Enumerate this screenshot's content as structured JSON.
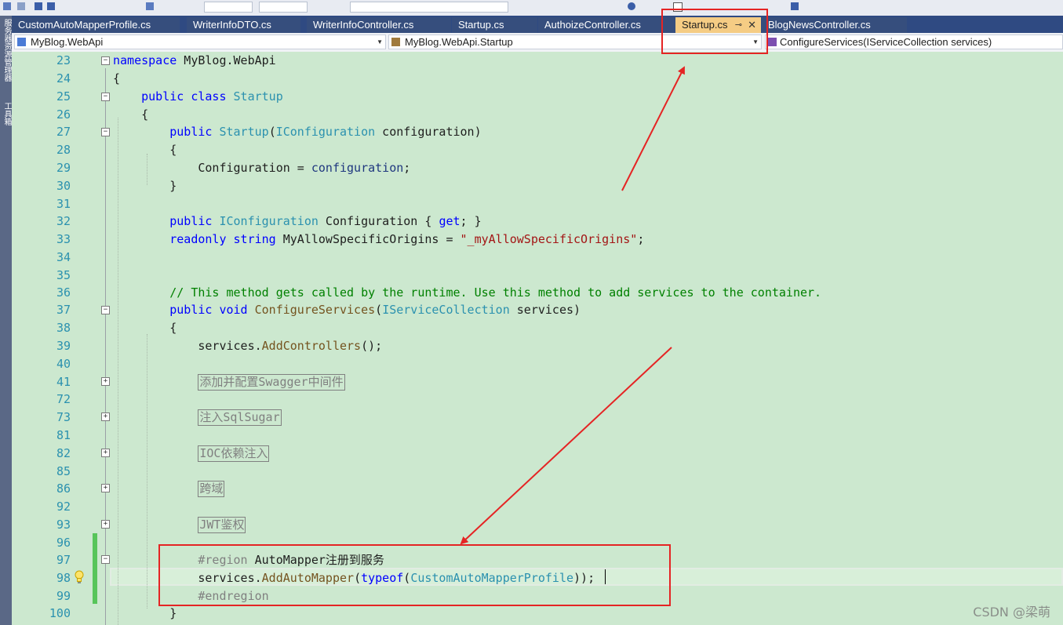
{
  "side_panel": {
    "tab1": "服务器资源管理器",
    "tab2": "工具箱"
  },
  "tabs": [
    {
      "label": "CustomAutoMapperProfile.cs"
    },
    {
      "label": "WriterInfoDTO.cs"
    },
    {
      "label": "WriterInfoController.cs"
    },
    {
      "label": "Startup.cs"
    },
    {
      "label": "AuthoizeController.cs"
    },
    {
      "label": "Startup.cs",
      "active": true
    },
    {
      "label": "BlogNewsController.cs"
    }
  ],
  "active_tab": {
    "pin_icon": "⊸",
    "close_icon": "✕"
  },
  "nav": {
    "project": "MyBlog.WebApi",
    "type": "MyBlog.WebApi.Startup",
    "member": "ConfigureServices(IServiceCollection services)"
  },
  "line_numbers": [
    "23",
    "24",
    "25",
    "26",
    "27",
    "28",
    "29",
    "30",
    "31",
    "32",
    "33",
    "34",
    "35",
    "36",
    "37",
    "38",
    "39",
    "40",
    "41",
    "72",
    "73",
    "81",
    "82",
    "85",
    "86",
    "92",
    "93",
    "96",
    "97",
    "98",
    "99",
    "100"
  ],
  "code": {
    "l23_kw": "namespace",
    "l23_rest": " MyBlog.WebApi",
    "l24": "{",
    "l25_kw1": "public",
    "l25_kw2": "class",
    "l25_ty": "Startup",
    "l26": "{",
    "l27_kw": "public",
    "l27_ty": "Startup",
    "l27_p1": "(",
    "l27_ty2": "IConfiguration",
    "l27_p2": " configuration)",
    "l28": "{",
    "l29_a": "Configuration = ",
    "l29_b": "configuration",
    "l29_c": ";",
    "l30": "}",
    "l32_kw": "public",
    "l32_ty": "IConfiguration",
    "l32_a": " Configuration { ",
    "l32_get": "get",
    "l32_b": "; }",
    "l33_kw1": "readonly",
    "l33_kw2": "string",
    "l33_a": " MyAllowSpecificOrigins = ",
    "l33_st": "\"_myAllowSpecificOrigins\"",
    "l33_b": ";",
    "l36": "// This method gets called by the runtime. Use this method to add services to the container.",
    "l37_kw1": "public",
    "l37_kw2": "void",
    "l37_me": "ConfigureServices",
    "l37_p1": "(",
    "l37_ty": "IServiceCollection",
    "l37_p2": " services)",
    "l38": "{",
    "l39_a": "services.",
    "l39_me": "AddControllers",
    "l39_b": "();",
    "region41": "添加并配置Swagger中间件",
    "region73": "注入SqlSugar",
    "region82": "IOC依赖注入",
    "region86": "跨域",
    "region93": "JWT鉴权",
    "l97_pp": "#region",
    "l97_rest": " AutoMapper注册到服务",
    "l98_a": "services.",
    "l98_me": "AddAutoMapper",
    "l98_b": "(",
    "l98_kw": "typeof",
    "l98_c": "(",
    "l98_ty": "CustomAutoMapperProfile",
    "l98_d": "));",
    "l99_pp": "#endregion",
    "l100": "}"
  },
  "watermark": "CSDN @梁萌",
  "colors": {
    "editor_bg": "#cce8cf",
    "tab_bg": "#2f4a82",
    "active_tab": "#f5cc84",
    "highlight": "#e52424"
  }
}
